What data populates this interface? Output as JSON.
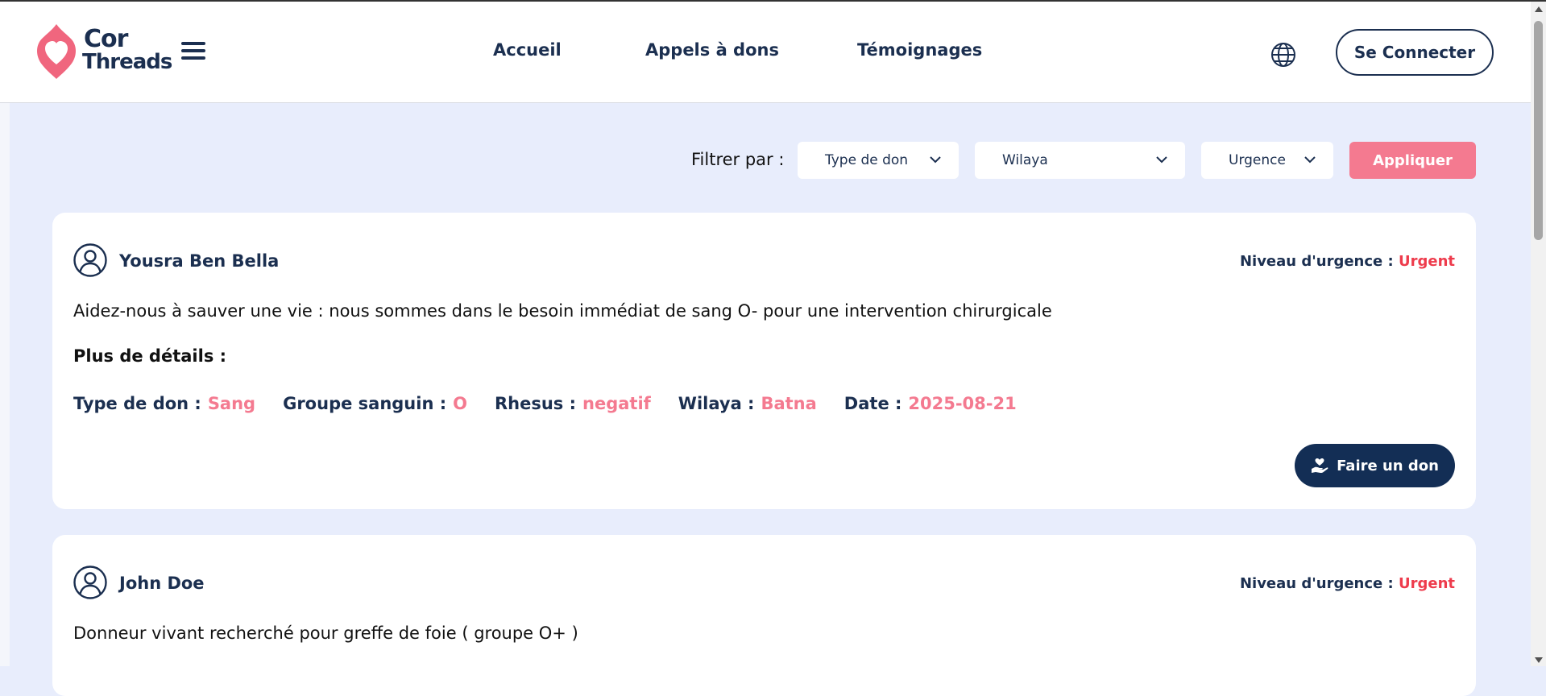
{
  "brand": {
    "line1": "Cor",
    "line2": "Threads",
    "accent": "#f0667e",
    "navy": "#1b2f50"
  },
  "nav": {
    "items": [
      "Accueil",
      "Appels à dons",
      "Témoignages"
    ]
  },
  "header": {
    "login_label": "Se Connecter"
  },
  "filters": {
    "label": "Filtrer par :",
    "type_placeholder": "Type de don",
    "wilaya_placeholder": "Wilaya",
    "urgency_placeholder": "Urgence",
    "apply_label": "Appliquer"
  },
  "posts": [
    {
      "author": "Yousra Ben Bella",
      "urgency_label": "Niveau d'urgence :",
      "urgency_value": "Urgent",
      "description": "Aidez-nous à sauver une vie : nous sommes dans le besoin immédiat de sang O- pour une intervention chirurgicale",
      "more_label": "Plus de détails :",
      "details": [
        {
          "label": "Type de don :",
          "value": "Sang"
        },
        {
          "label": "Groupe sanguin :",
          "value": "O"
        },
        {
          "label": "Rhesus :",
          "value": "negatif"
        },
        {
          "label": "Wilaya :",
          "value": "Batna"
        },
        {
          "label": "Date :",
          "value": "2025-08-21"
        }
      ],
      "donate_label": "Faire un don"
    },
    {
      "author": "John Doe",
      "urgency_label": "Niveau d'urgence :",
      "urgency_value": "Urgent",
      "description": "Donneur vivant recherché pour greffe de foie ( groupe O+ )"
    }
  ]
}
